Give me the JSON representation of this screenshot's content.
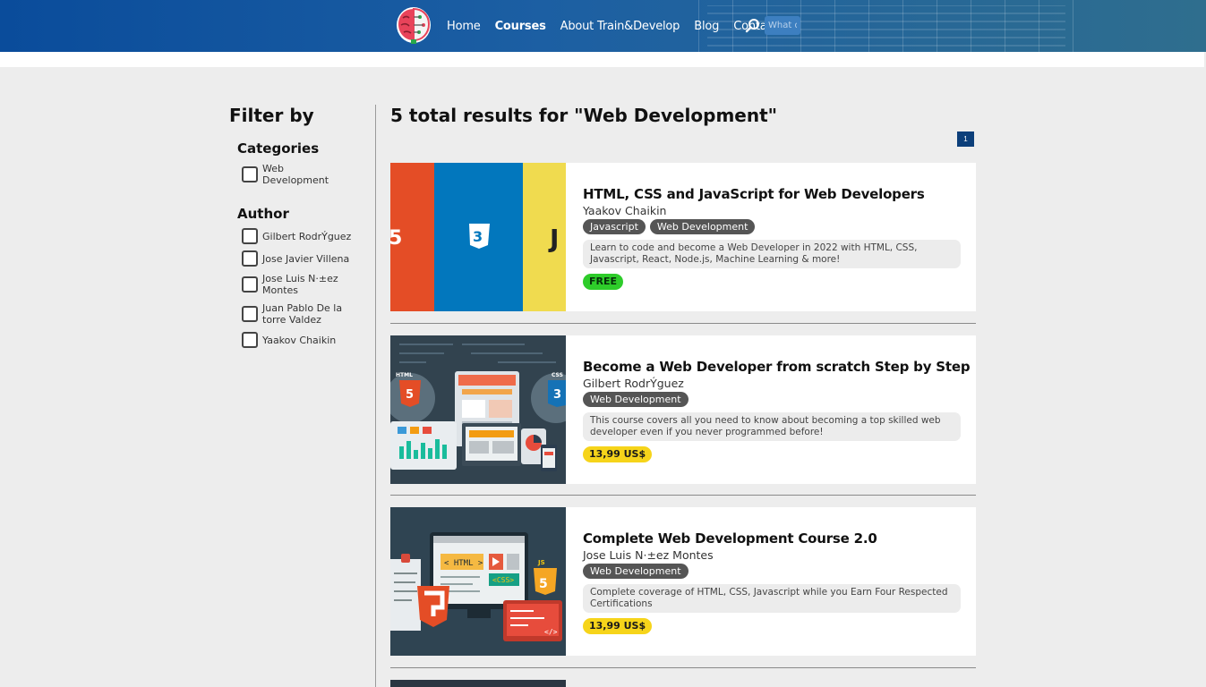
{
  "nav": {
    "items": [
      "Home",
      "Courses",
      "About Train&Develop",
      "Blog",
      "Contact"
    ],
    "active": "Courses"
  },
  "search": {
    "placeholder": "What do you want to learn?"
  },
  "sidebar": {
    "title": "Filter by",
    "categories_title": "Categories",
    "categories": [
      "Web Development"
    ],
    "author_title": "Author",
    "authors": [
      "Gilbert RodrÝguez",
      "Jose Javier Villena",
      "Jose Luis N·±ez Montes",
      "Juan Pablo De la torre Valdez",
      "Yaakov Chaikin"
    ]
  },
  "results": {
    "heading": "5 total results for \"Web Development\"",
    "page": "1",
    "courses": [
      {
        "title": "HTML, CSS and JavaScript for Web Developers",
        "author": "Yaakov Chaikin",
        "tags": [
          "Javascript",
          "Web Development"
        ],
        "description": "Learn to code and become a Web Developer in 2022 with HTML, CSS, Javascript, React, Node.js, Machine Learning & more!",
        "price": "FREE"
      },
      {
        "title": "Become a Web Developer from scratch Step by Step",
        "author": "Gilbert RodrÝguez",
        "tags": [
          "Web Development"
        ],
        "description": "This course covers all you need to know about becoming a top skilled web developer even if you never programmed before!",
        "price": "13,99 US$"
      },
      {
        "title": "Complete Web Development Course 2.0",
        "author": "Jose Luis N·±ez Montes",
        "tags": [
          "Web Development"
        ],
        "description": "Complete coverage of HTML, CSS, Javascript while you Earn Four Respected Certifications",
        "price": "13,99 US$"
      }
    ]
  },
  "colors": {
    "header": "#0a4c9b",
    "free": "#2ecc2a",
    "paid": "#f6d41a",
    "tag": "#555555",
    "page": "#0c3f7a"
  },
  "thumb_text": {
    "html": "HTML",
    "css": "CSS",
    "js": "JS",
    "html_tag": "< HTML >",
    "css_tag": "<CSS>"
  }
}
